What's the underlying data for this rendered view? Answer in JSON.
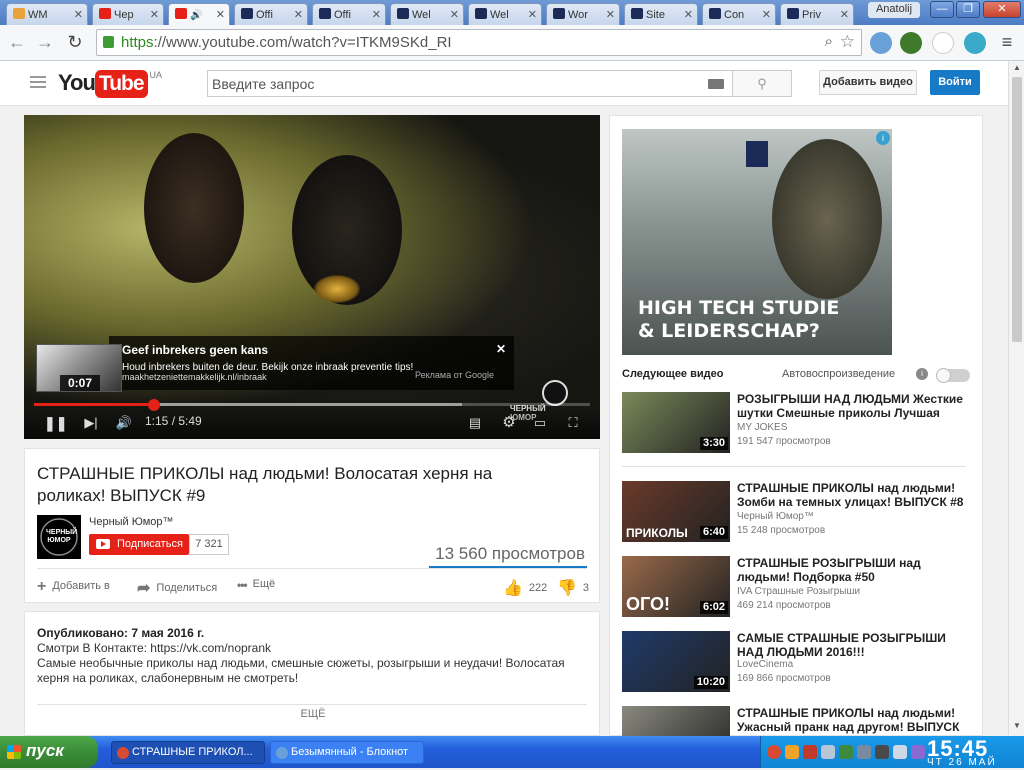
{
  "browser": {
    "tabs": [
      {
        "label": "WM",
        "color": "#e8a33c"
      },
      {
        "label": "Чер",
        "color": "#e62117"
      },
      {
        "label": "",
        "color": "#e62117",
        "active": true
      },
      {
        "label": "Offi",
        "color": "#1b2a56"
      },
      {
        "label": "Offi",
        "color": "#1b2a56"
      },
      {
        "label": "Wel",
        "color": "#1b2a56"
      },
      {
        "label": "Wel",
        "color": "#1b2a56"
      },
      {
        "label": "Wor",
        "color": "#1b2a56"
      },
      {
        "label": "Site",
        "color": "#1b2a56"
      },
      {
        "label": "Con",
        "color": "#1b2a56"
      },
      {
        "label": "Priv",
        "color": "#1b2a56"
      }
    ],
    "user": "Anatolij",
    "url_scheme": "https",
    "url_rest": "://www.youtube.com/watch?v=ITKM9SKd_RI"
  },
  "youtube": {
    "logo_you": "You",
    "logo_tube": "Tube",
    "region": "UA",
    "search_placeholder": "Введите запрос",
    "upload_label": "Добавить видео",
    "signin_label": "Войти"
  },
  "player": {
    "ad_title": "Geef inbrekers geen kans",
    "ad_text": "Houd inbrekers buiten de deur. Bekijk onze inbraak preventie tips!",
    "ad_url": "maakhetzeniettemakkelijk.nl/inbraak",
    "ad_by": "Реклама от Google",
    "ad_thumb_time": "0:07",
    "time": "1:15 / 5:49",
    "progress_played": 0.215,
    "progress_loaded": 0.77,
    "watermark": "ЧЕРНЫЙ ЮМОР"
  },
  "video": {
    "title": "СТРАШНЫЕ ПРИКОЛЫ над людьми! Волосатая херня на роликах! ВЫПУСК #9",
    "channel": "Черный Юмор™",
    "avatar_text": "ЧЕРНЫЙ ЮМОР",
    "subscribe_label": "Подписаться",
    "subscribers": "7 321",
    "views": "13 560 просмотров",
    "add_to": "Добавить в",
    "share": "Поделиться",
    "more_actions": "Ещё",
    "likes": "222",
    "dislikes": "3"
  },
  "description": {
    "published": "Опубликовано: 7 мая 2016 г.",
    "line1": "Смотри В Контакте: https://vk.com/noprank",
    "line2": "Самые необычные приколы над людьми, смешные сюжеты, розыгрыши и неудачи! Волосатая херня на роликах, слабонервным не смотреть!",
    "more": "ЕЩЁ"
  },
  "sidebar": {
    "ad_headline_1": "HIGH TECH STUDIE",
    "ad_headline_2": "& LEIDERSCHAP?",
    "up_next": "Следующее видео",
    "autoplay": "Автовоспроизведение",
    "recommendations": [
      {
        "title": "РОЗЫГРЫШИ НАД ЛЮДЬМИ Жесткие шутки Смешные приколы Лучшая",
        "channel": "MY JOKES",
        "views": "191 547 просмотров",
        "duration": "3:30",
        "thumb": "#7a8a5a"
      },
      {
        "title": "СТРАШНЫЕ ПРИКОЛЫ над людьми! Зомби на темных улицах! ВЫПУСК #8",
        "channel": "Черный Юмор™",
        "views": "15 248 просмотров",
        "duration": "6:40",
        "thumb": "#6a3a2a",
        "overlay": "ПРИКОЛЫ"
      },
      {
        "title": "СТРАШНЫЕ РОЗЫГРЫШИ над людьми! Подборка #50",
        "channel": "IVA Страшные Розыгрыши",
        "views": "469 214 просмотров",
        "duration": "6:02",
        "thumb": "#9a6a4a",
        "overlay": "ОГО!"
      },
      {
        "title": "САМЫЕ СТРАШНЫЕ РОЗЫГРЫШИ НАД ЛЮДЬМИ 2016!!!",
        "channel": "LoveCinema",
        "views": "169 866 просмотров",
        "duration": "10:20",
        "thumb": "#1f3a6a"
      },
      {
        "title": "СТРАШНЫЕ ПРИКОЛЫ над людьми! Ужасный пранк над другом! ВЫПУСК",
        "channel": "",
        "views": "",
        "duration": "",
        "thumb": "#8a8a80"
      }
    ]
  },
  "taskbar": {
    "start": "пуск",
    "tasks": [
      {
        "label": "СТРАШНЫЕ ПРИКОЛ...",
        "active": true
      },
      {
        "label": "Безымянный - Блокнот",
        "active": false
      }
    ],
    "time": "15:45",
    "date": "ЧТ 26 МАЙ"
  }
}
